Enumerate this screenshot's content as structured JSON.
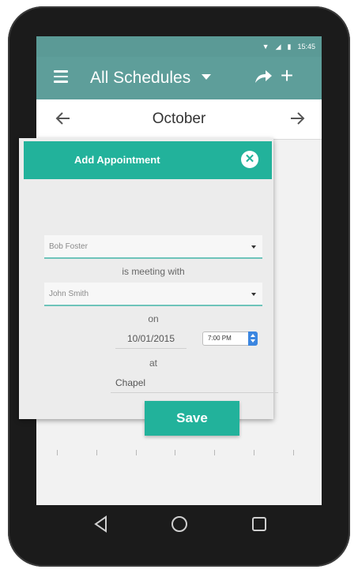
{
  "status_bar": {
    "time": "15:45"
  },
  "app_bar": {
    "title": "All Schedules",
    "menu_icon": "hamburger-menu-icon",
    "share_icon": "share-arrow-icon",
    "add_icon": "plus-icon"
  },
  "calendar": {
    "month": "October",
    "prev_icon": "arrow-left-icon",
    "next_icon": "arrow-right-icon"
  },
  "dialog": {
    "title": "Add Appointment",
    "close_icon": "close-circle-icon",
    "organizer_value": "Bob Foster",
    "connector_1": "is meeting with",
    "attendee_value": "John Smith",
    "connector_2": "on",
    "date_value": "10/01/2015",
    "time_value": "7:00 PM",
    "connector_3": "at",
    "location_value": "Chapel",
    "save_label": "Save"
  },
  "colors": {
    "app_bar": "#5e9e9a",
    "accent": "#22b29b",
    "device": "#1b1b1b"
  }
}
